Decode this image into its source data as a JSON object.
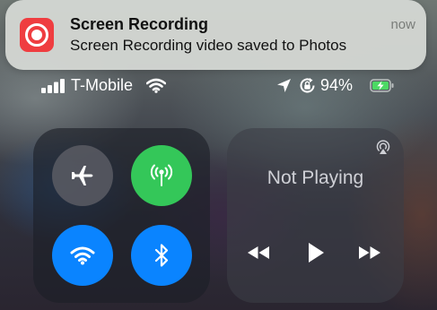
{
  "notification": {
    "app_icon": "screen-recording-icon",
    "title": "Screen Recording",
    "body": "Screen Recording video saved to Photos",
    "time": "now",
    "icon_color": "#ef3d40"
  },
  "status_bar": {
    "signal_icon": "cellular-signal-icon",
    "carrier": "T-Mobile",
    "wifi_icon": "wifi-icon",
    "location_icon": "location-arrow-icon",
    "rotation_lock_icon": "rotation-lock-icon",
    "battery_percent": "94%",
    "battery_charging": true
  },
  "connectivity": {
    "airplane_mode": {
      "icon": "airplane-icon",
      "active": false
    },
    "cellular_data": {
      "icon": "cellular-antenna-icon",
      "active": true,
      "color": "#34c759"
    },
    "wifi": {
      "icon": "wifi-icon",
      "active": true,
      "color": "#0a84ff"
    },
    "bluetooth": {
      "icon": "bluetooth-icon",
      "active": true,
      "color": "#0a84ff"
    }
  },
  "media": {
    "airplay_icon": "airplay-icon",
    "now_playing": "Not Playing",
    "controls": [
      "rewind-icon",
      "play-icon",
      "fast-forward-icon"
    ]
  }
}
